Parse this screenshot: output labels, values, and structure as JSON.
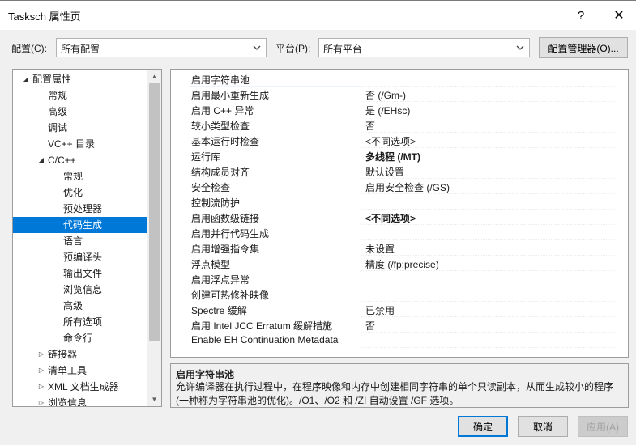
{
  "window": {
    "title": "Tasksch 属性页",
    "help_label": "?",
    "close_label": "✕"
  },
  "config": {
    "label": "配置(C):",
    "value": "所有配置"
  },
  "platform": {
    "label": "平台(P):",
    "value": "所有平台"
  },
  "config_manager_label": "配置管理器(O)...",
  "tree": {
    "items": [
      {
        "label": "配置属性",
        "glyph": "◢",
        "depth": 0
      },
      {
        "label": "常规",
        "glyph": "",
        "depth": 1
      },
      {
        "label": "高级",
        "glyph": "",
        "depth": 1
      },
      {
        "label": "调试",
        "glyph": "",
        "depth": 1
      },
      {
        "label": "VC++ 目录",
        "glyph": "",
        "depth": 1
      },
      {
        "label": "C/C++",
        "glyph": "◢",
        "depth": 1
      },
      {
        "label": "常规",
        "glyph": "",
        "depth": 2
      },
      {
        "label": "优化",
        "glyph": "",
        "depth": 2
      },
      {
        "label": "预处理器",
        "glyph": "",
        "depth": 2
      },
      {
        "label": "代码生成",
        "glyph": "",
        "depth": 2,
        "selected": true
      },
      {
        "label": "语言",
        "glyph": "",
        "depth": 2
      },
      {
        "label": "预编译头",
        "glyph": "",
        "depth": 2
      },
      {
        "label": "输出文件",
        "glyph": "",
        "depth": 2
      },
      {
        "label": "浏览信息",
        "glyph": "",
        "depth": 2
      },
      {
        "label": "高级",
        "glyph": "",
        "depth": 2
      },
      {
        "label": "所有选项",
        "glyph": "",
        "depth": 2
      },
      {
        "label": "命令行",
        "glyph": "",
        "depth": 2
      },
      {
        "label": "链接器",
        "glyph": "▷",
        "depth": 1
      },
      {
        "label": "清单工具",
        "glyph": "▷",
        "depth": 1
      },
      {
        "label": "XML 文档生成器",
        "glyph": "▷",
        "depth": 1
      },
      {
        "label": "浏览信息",
        "glyph": "▷",
        "depth": 1
      }
    ]
  },
  "properties": [
    {
      "name": "启用字符串池",
      "value": ""
    },
    {
      "name": "启用最小重新生成",
      "value": "否 (/Gm-)"
    },
    {
      "name": "启用 C++ 异常",
      "value": "是 (/EHsc)"
    },
    {
      "name": "较小类型检查",
      "value": "否"
    },
    {
      "name": "基本运行时检查",
      "value": "<不同选项>"
    },
    {
      "name": "运行库",
      "value": "多线程 (/MT)",
      "bold": true
    },
    {
      "name": "结构成员对齐",
      "value": "默认设置"
    },
    {
      "name": "安全检查",
      "value": "启用安全检查 (/GS)"
    },
    {
      "name": "控制流防护",
      "value": ""
    },
    {
      "name": "启用函数级链接",
      "value": "<不同选项>",
      "bold": true
    },
    {
      "name": "启用并行代码生成",
      "value": ""
    },
    {
      "name": "启用增强指令集",
      "value": "未设置"
    },
    {
      "name": "浮点模型",
      "value": "精度 (/fp:precise)"
    },
    {
      "name": "启用浮点异常",
      "value": ""
    },
    {
      "name": "创建可热修补映像",
      "value": ""
    },
    {
      "name": "Spectre 缓解",
      "value": "已禁用"
    },
    {
      "name": "启用 Intel JCC Erratum 缓解措施",
      "value": "否"
    },
    {
      "name": "Enable EH Continuation Metadata",
      "value": ""
    }
  ],
  "description": {
    "title": "启用字符串池",
    "text": "允许编译器在执行过程中，在程序映像和内存中创建相同字符串的单个只读副本，从而生成较小的程序(一种称为字符串池的优化)。/O1、/O2 和 /ZI 自动设置 /GF 选项。"
  },
  "buttons": {
    "ok": "确定",
    "cancel": "取消",
    "apply": "应用(A)"
  },
  "colors": {
    "selection": "#0078d7",
    "window_bg": "#f0f0f0"
  }
}
